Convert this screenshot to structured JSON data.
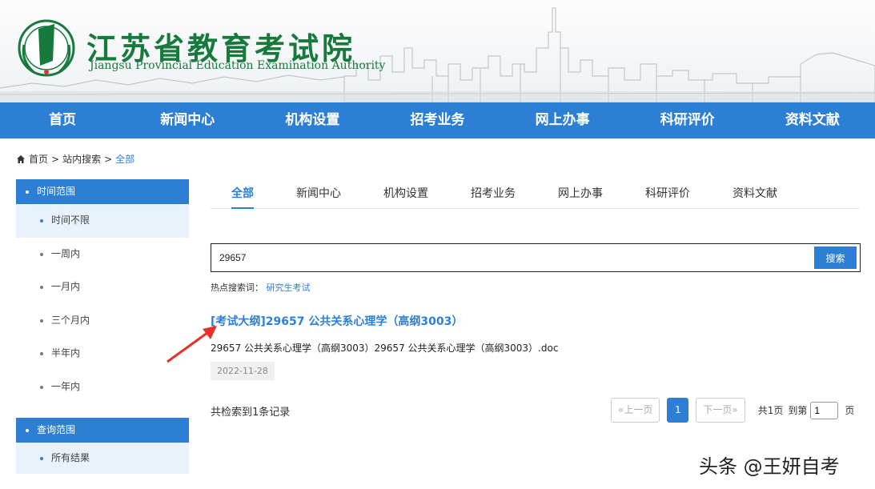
{
  "header": {
    "title": "江苏省教育考试院",
    "subtitle": "Jiangsu Provincial Education Examination Authority"
  },
  "nav": [
    "首页",
    "新闻中心",
    "机构设置",
    "招考业务",
    "网上办事",
    "科研评价",
    "资料文献"
  ],
  "breadcrumb": {
    "home": "首页",
    "sep1": ">",
    "search": "站内搜索",
    "sep2": ">",
    "current": "全部"
  },
  "sidebar": {
    "time_range": {
      "title": "时间范围",
      "items": [
        "时间不限",
        "一周内",
        "一月内",
        "三个月内",
        "半年内",
        "一年内"
      ],
      "selected": "时间不限"
    },
    "query_range": {
      "title": "查询范围",
      "items": [
        "所有结果"
      ],
      "selected": "所有结果"
    }
  },
  "tabs": [
    "全部",
    "新闻中心",
    "机构设置",
    "招考业务",
    "网上办事",
    "科研评价",
    "资料文献"
  ],
  "search": {
    "value": "29657",
    "button": "搜索",
    "hot_label": "热点搜索词：",
    "hot_terms": [
      "研究生考试"
    ]
  },
  "result": {
    "title": "[考试大纲]29657 公共关系心理学（高纲3003）",
    "description": "29657 公共关系心理学（高纲3003）29657 公共关系心理学（高纲3003）.doc",
    "date": "2022-11-28"
  },
  "footer": {
    "count_text": "共检索到1条记录",
    "prev": "«上一页",
    "current_page": "1",
    "next": "下一页»",
    "total_pages": "共1页",
    "goto_label": "到第",
    "goto_value": "1",
    "page_unit": "页"
  },
  "watermark": "头条 @王妍自考",
  "colors": {
    "primary": "#2d7fd6",
    "brand_green": "#157a3c",
    "arrow_red": "#e8302a"
  }
}
